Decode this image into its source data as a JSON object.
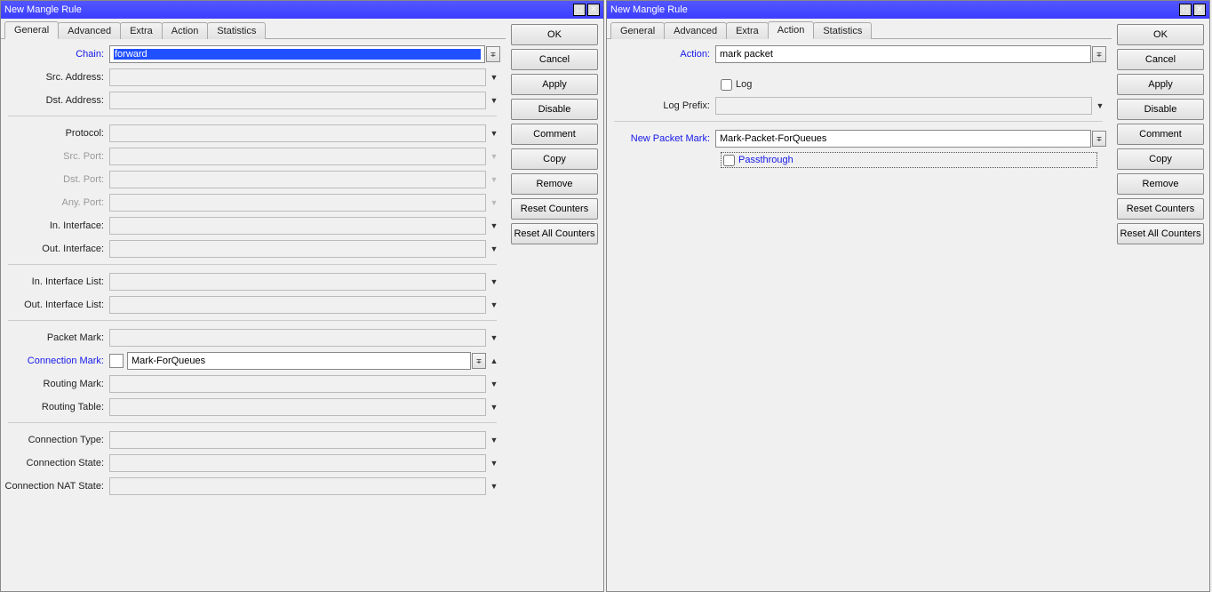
{
  "titles": {
    "left": "New Mangle Rule",
    "right": "New Mangle Rule"
  },
  "tabs": {
    "general": "General",
    "advanced": "Advanced",
    "extra": "Extra",
    "action": "Action",
    "statistics": "Statistics"
  },
  "buttons": {
    "ok": "OK",
    "cancel": "Cancel",
    "apply": "Apply",
    "disable": "Disable",
    "comment": "Comment",
    "copy": "Copy",
    "remove": "Remove",
    "reset_counters": "Reset Counters",
    "reset_all_counters": "Reset All Counters"
  },
  "left_form": {
    "chain_label": "Chain:",
    "chain_value": "forward",
    "src_addr_label": "Src. Address:",
    "dst_addr_label": "Dst. Address:",
    "protocol_label": "Protocol:",
    "src_port_label": "Src. Port:",
    "dst_port_label": "Dst. Port:",
    "any_port_label": "Any. Port:",
    "in_if_label": "In. Interface:",
    "out_if_label": "Out. Interface:",
    "in_if_list_label": "In. Interface List:",
    "out_if_list_label": "Out. Interface List:",
    "packet_mark_label": "Packet Mark:",
    "conn_mark_label": "Connection Mark:",
    "conn_mark_value": "Mark-ForQueues",
    "routing_mark_label": "Routing Mark:",
    "routing_table_label": "Routing Table:",
    "conn_type_label": "Connection Type:",
    "conn_state_label": "Connection State:",
    "conn_nat_state_label": "Connection NAT State:"
  },
  "right_form": {
    "action_label": "Action:",
    "action_value": "mark packet",
    "log_label": "Log",
    "log_prefix_label": "Log Prefix:",
    "new_packet_mark_label": "New Packet Mark:",
    "new_packet_mark_value": "Mark-Packet-ForQueues",
    "passthrough_label": "Passthrough"
  }
}
